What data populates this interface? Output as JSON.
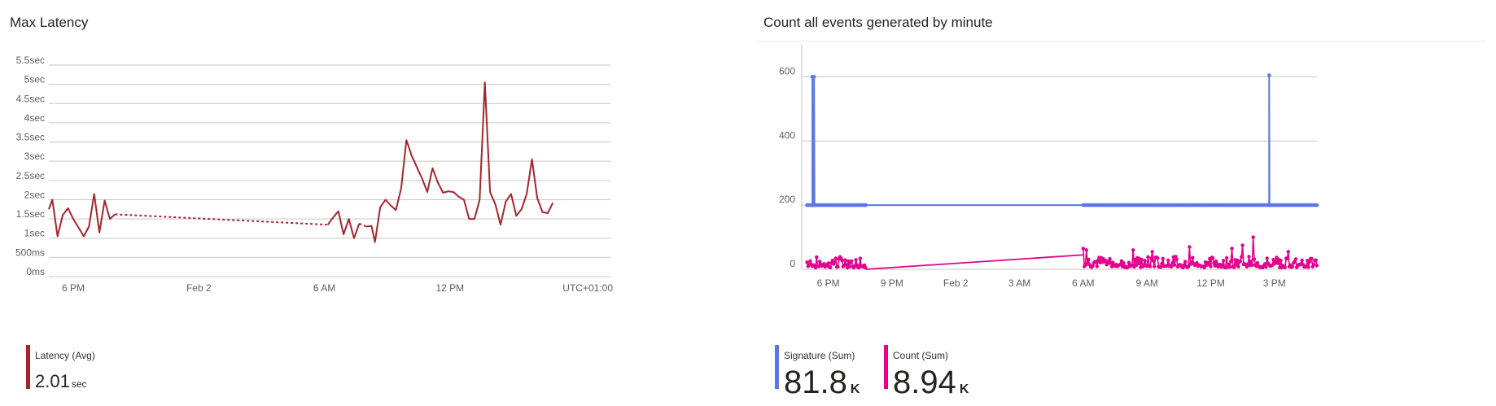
{
  "chart_data": [
    {
      "type": "line",
      "title": "Max Latency",
      "ylabel": "",
      "xlabel": "",
      "ylim": [
        0,
        5.5
      ],
      "y_tick_values": [
        0,
        0.5,
        1,
        1.5,
        2,
        2.5,
        3,
        3.5,
        4,
        4.5,
        5,
        5.5
      ],
      "y_tick_labels": [
        "0ms",
        "500ms",
        "1sec",
        "1.5sec",
        "2sec",
        "2.5sec",
        "3sec",
        "3.5sec",
        "4sec",
        "4.5sec",
        "5sec",
        "5.5sec"
      ],
      "x_range": [
        "Feb 1 16:50",
        "Feb 2 19:40"
      ],
      "x_tick_values": [
        "Feb 1 18:00",
        "Feb 2 00:00",
        "Feb 2 06:00",
        "Feb 2 12:00"
      ],
      "x_tick_labels": [
        "6 PM",
        "Feb 2",
        "6 AM",
        "12 PM"
      ],
      "timezone_label": "UTC+01:00",
      "grid": true,
      "series": [
        {
          "name": "Latency (Avg)",
          "color": "#a4262c",
          "segments": [
            {
              "style": "solid",
              "points": [
                [
                  "Feb 1 16:50",
                  1.75
                ],
                [
                  "Feb 1 17:00",
                  2.0
                ],
                [
                  "Feb 1 17:15",
                  1.05
                ],
                [
                  "Feb 1 17:30",
                  1.6
                ],
                [
                  "Feb 1 17:45",
                  1.78
                ],
                [
                  "Feb 1 18:00",
                  1.5
                ],
                [
                  "Feb 1 18:15",
                  1.28
                ],
                [
                  "Feb 1 18:30",
                  1.05
                ],
                [
                  "Feb 1 18:45",
                  1.3
                ],
                [
                  "Feb 1 19:00",
                  2.15
                ],
                [
                  "Feb 1 19:15",
                  1.15
                ],
                [
                  "Feb 1 19:30",
                  1.98
                ],
                [
                  "Feb 1 19:45",
                  1.5
                ],
                [
                  "Feb 1 20:00",
                  1.62
                ]
              ]
            },
            {
              "style": "dashed",
              "points": [
                [
                  "Feb 1 20:00",
                  1.62
                ],
                [
                  "Feb 2 06:10",
                  1.35
                ]
              ]
            },
            {
              "style": "solid",
              "points": [
                [
                  "Feb 2 06:10",
                  1.35
                ],
                [
                  "Feb 2 06:20",
                  1.48
                ],
                [
                  "Feb 2 06:40",
                  1.7
                ],
                [
                  "Feb 2 06:55",
                  1.1
                ],
                [
                  "Feb 2 07:10",
                  1.5
                ],
                [
                  "Feb 2 07:25",
                  1.0
                ],
                [
                  "Feb 2 07:40",
                  1.38
                ]
              ]
            },
            {
              "style": "dashed",
              "points": [
                [
                  "Feb 2 07:40",
                  1.38
                ],
                [
                  "Feb 2 08:00",
                  1.3
                ]
              ]
            },
            {
              "style": "solid",
              "points": [
                [
                  "Feb 2 08:00",
                  1.3
                ],
                [
                  "Feb 2 08:15",
                  1.32
                ],
                [
                  "Feb 2 08:25",
                  0.9
                ],
                [
                  "Feb 2 08:40",
                  1.8
                ],
                [
                  "Feb 2 08:55",
                  2.0
                ],
                [
                  "Feb 2 09:10",
                  1.85
                ],
                [
                  "Feb 2 09:25",
                  1.73
                ],
                [
                  "Feb 2 09:40",
                  2.3
                ],
                [
                  "Feb 2 09:55",
                  3.55
                ],
                [
                  "Feb 2 10:10",
                  3.15
                ],
                [
                  "Feb 2 10:25",
                  2.85
                ],
                [
                  "Feb 2 10:40",
                  2.55
                ],
                [
                  "Feb 2 10:55",
                  2.2
                ],
                [
                  "Feb 2 11:10",
                  2.82
                ],
                [
                  "Feb 2 11:25",
                  2.45
                ],
                [
                  "Feb 2 11:40",
                  2.18
                ],
                [
                  "Feb 2 11:55",
                  2.22
                ],
                [
                  "Feb 2 12:10",
                  2.2
                ],
                [
                  "Feb 2 12:25",
                  2.08
                ],
                [
                  "Feb 2 12:40",
                  2.0
                ],
                [
                  "Feb 2 12:55",
                  1.5
                ],
                [
                  "Feb 2 13:10",
                  1.5
                ],
                [
                  "Feb 2 13:25",
                  2.0
                ],
                [
                  "Feb 2 13:40",
                  5.05
                ],
                [
                  "Feb 2 13:55",
                  2.2
                ],
                [
                  "Feb 2 14:10",
                  1.88
                ],
                [
                  "Feb 2 14:25",
                  1.35
                ],
                [
                  "Feb 2 14:40",
                  1.95
                ],
                [
                  "Feb 2 14:55",
                  2.15
                ],
                [
                  "Feb 2 15:10",
                  1.58
                ],
                [
                  "Feb 2 15:25",
                  1.75
                ],
                [
                  "Feb 2 15:40",
                  2.15
                ],
                [
                  "Feb 2 15:55",
                  3.05
                ],
                [
                  "Feb 2 16:10",
                  2.05
                ],
                [
                  "Feb 2 16:25",
                  1.68
                ],
                [
                  "Feb 2 16:40",
                  1.65
                ],
                [
                  "Feb 2 16:55",
                  1.92
                ]
              ]
            }
          ]
        }
      ],
      "legend": [
        {
          "label": "Latency (Avg)",
          "value": "2.01",
          "unit": "sec",
          "color": "#a4262c"
        }
      ]
    },
    {
      "type": "line",
      "title": "Count all events generated by minute",
      "ylabel": "",
      "xlabel": "",
      "ylim": [
        0,
        700
      ],
      "y_tick_values": [
        0,
        200,
        400,
        600
      ],
      "y_tick_labels": [
        "0",
        "200",
        "400",
        "600"
      ],
      "x_range": [
        "Feb 1 16:45",
        "Feb 2 17:00"
      ],
      "x_tick_values": [
        "Feb 1 18:00",
        "Feb 1 21:00",
        "Feb 2 00:00",
        "Feb 2 03:00",
        "Feb 2 06:00",
        "Feb 2 09:00",
        "Feb 2 12:00",
        "Feb 2 15:00"
      ],
      "x_tick_labels": [
        "6 PM",
        "9 PM",
        "Feb 2",
        "3 AM",
        "6 AM",
        "9 AM",
        "12 PM",
        "3 PM"
      ],
      "grid": true,
      "series": [
        {
          "name": "Signature (Sum)",
          "color": "#5b77e6",
          "baseline": 200,
          "active_ranges": [
            [
              "Feb 1 17:00",
              "Feb 1 19:45"
            ],
            [
              "Feb 2 06:00",
              "Feb 2 17:00"
            ]
          ],
          "spikes": [
            [
              "Feb 1 17:15",
              600
            ],
            [
              "Feb 1 17:20",
              600
            ],
            [
              "Feb 2 14:45",
              605
            ]
          ]
        },
        {
          "name": "Count (Sum)",
          "color": "#e3008c",
          "active_ranges": [
            [
              "Feb 1 17:00",
              "Feb 1 19:45"
            ],
            [
              "Feb 2 06:00",
              "Feb 2 17:00"
            ]
          ],
          "bridge": [
            [
              "Feb 1 19:45",
              0
            ],
            [
              "Feb 2 06:00",
              45
            ]
          ],
          "typical_range": [
            0,
            50
          ],
          "peak_samples": [
            [
              "Feb 2 06:00",
              65
            ],
            [
              "Feb 2 06:10",
              60
            ],
            [
              "Feb 2 08:20",
              60
            ],
            [
              "Feb 2 09:15",
              55
            ],
            [
              "Feb 2 11:00",
              70
            ],
            [
              "Feb 2 13:00",
              65
            ],
            [
              "Feb 2 13:30",
              75
            ],
            [
              "Feb 2 14:00",
              100
            ],
            [
              "Feb 2 15:40",
              55
            ]
          ]
        }
      ],
      "legend": [
        {
          "label": "Signature (Sum)",
          "value": "81.8",
          "unit": "K",
          "color": "#5b77e6"
        },
        {
          "label": "Count (Sum)",
          "value": "8.94",
          "unit": "K",
          "color": "#e3008c"
        }
      ]
    }
  ]
}
